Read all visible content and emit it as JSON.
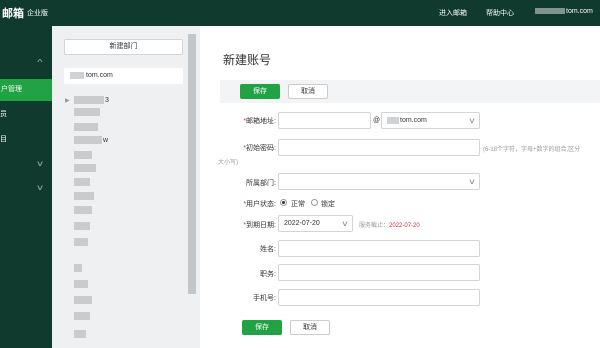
{
  "header": {
    "logo": "邮箱",
    "edition": "企业版",
    "links": [
      "进入邮箱",
      "帮助中心"
    ],
    "user_domain": "tom.com"
  },
  "sidebar": {
    "items": [
      {
        "label": "户管理",
        "active": true
      },
      {
        "label": "员",
        "active": false
      },
      {
        "label": "目",
        "active": false
      }
    ]
  },
  "dept_panel": {
    "new_dept_label": "新建部门",
    "root_domain": "tom.com",
    "tree_rows": [
      {
        "suffix": "3"
      },
      {
        "suffix": ""
      },
      {
        "suffix": ""
      },
      {
        "suffix": "w"
      },
      {
        "suffix": ""
      },
      {
        "suffix": ""
      },
      {
        "suffix": ""
      },
      {
        "suffix": ""
      },
      {
        "suffix": ""
      },
      {
        "suffix": ""
      },
      {
        "suffix": ""
      },
      {
        "suffix": ""
      },
      {
        "suffix": ""
      },
      {
        "suffix": ""
      },
      {
        "suffix": ""
      },
      {
        "suffix": ""
      }
    ]
  },
  "form": {
    "title": "新建账号",
    "save_label": "保存",
    "cancel_label": "取消",
    "email_label": "邮箱地址",
    "at_symbol": "@",
    "email_domain": "tom.com",
    "password_label": "初始密码",
    "password_hint_1": "(6-18个字符，字母+数字的组合,区分",
    "password_hint_2": "大小写)",
    "dept_label": "所属部门",
    "status_label": "用户状态",
    "status_options": [
      "正常",
      "锁定"
    ],
    "status_selected": "正常",
    "expiry_label": "到期日期",
    "expiry_value": "2022-07-20",
    "service_end_label": "服务截止：",
    "service_end_value": "2022-07-20",
    "name_label": "姓名",
    "position_label": "职务",
    "phone_label": "手机号",
    "bottom_save_label": "保存",
    "bottom_cancel_label": "取消"
  },
  "colors": {
    "brand_dark": "#0f3a2d",
    "accent_green": "#21a345",
    "required_red": "#e02b2b"
  }
}
